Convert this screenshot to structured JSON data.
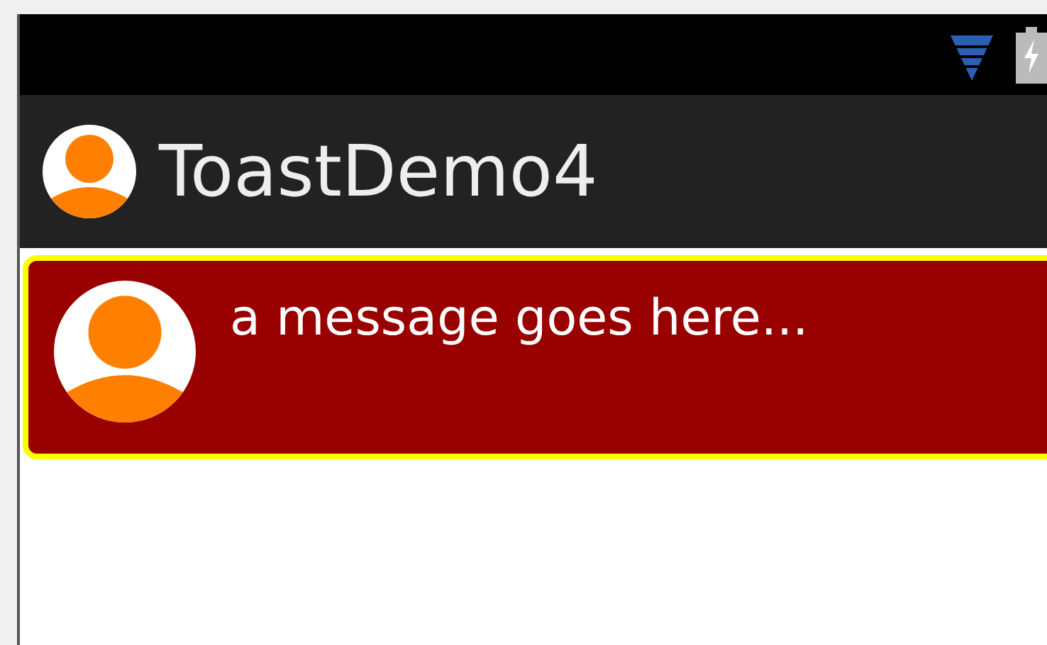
{
  "app_bar": {
    "title": "ToastDemo4"
  },
  "toast": {
    "message": "a message goes here..."
  }
}
